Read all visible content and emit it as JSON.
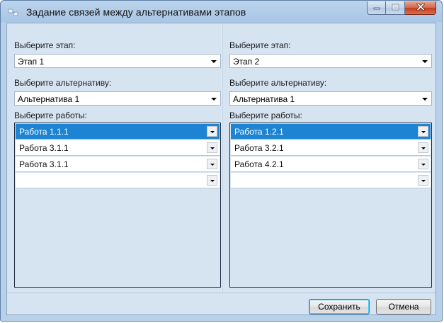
{
  "window": {
    "title": "Задание связей между альтернативами этапов"
  },
  "left": {
    "stage_label": "Выберите этап:",
    "stage_value": "Этап 1",
    "alt_label": "Выберите альтернативу:",
    "alt_value": "Альтернатива 1",
    "works_label": "Выберите работы:",
    "works": [
      "Работа 1.1.1",
      "Работа 3.1.1",
      "Работа 3.1.1",
      ""
    ]
  },
  "right": {
    "stage_label": "Выберите этап:",
    "stage_value": "Этап 2",
    "alt_label": "Выберите альтернативу:",
    "alt_value": "Альтернатива 1",
    "works_label": "Выберите работы:",
    "works": [
      "Работа 1.2.1",
      "Работа 3.2.1",
      "Работа 4.2.1",
      ""
    ]
  },
  "buttons": {
    "save": "Сохранить",
    "cancel": "Отмена"
  },
  "icons": {
    "app": "app-icon",
    "minimize": "minimize-icon",
    "maximize": "maximize-icon",
    "close": "close-icon"
  }
}
